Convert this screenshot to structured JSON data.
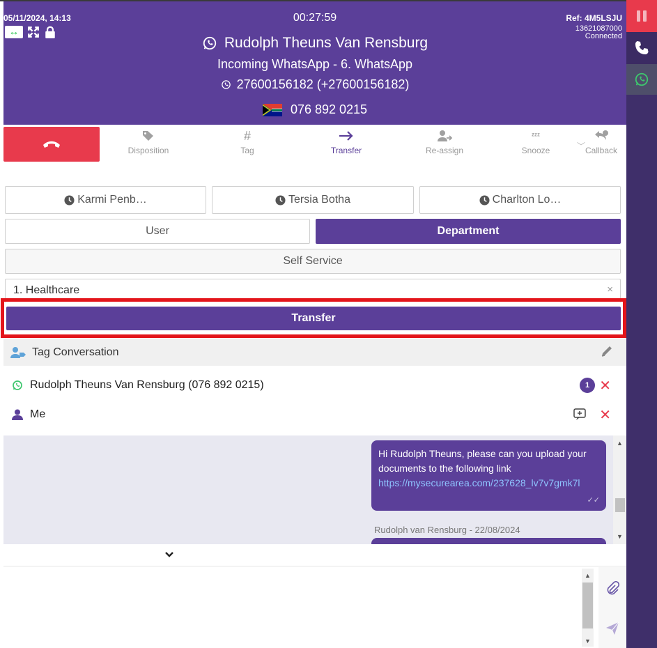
{
  "header": {
    "datetime": "05/11/2024, 14:13",
    "timer": "00:27:59",
    "ref": "Ref: 4M5LSJU",
    "ref_number": "13621087000",
    "status": "Connected",
    "contact_name": "Rudolph Theuns Van Rensburg",
    "interaction_type": "Incoming WhatsApp - 6. WhatsApp",
    "whatsapp_number": "27600156182 (+27600156182)",
    "contact_number": "076 892 0215"
  },
  "toolbar": {
    "items": [
      {
        "label": "Disposition",
        "icon": "tag-icon"
      },
      {
        "label": "Tag",
        "icon": "hash-icon"
      },
      {
        "label": "Transfer",
        "icon": "arrow-right-icon"
      },
      {
        "label": "Re-assign",
        "icon": "user-transfer-icon"
      },
      {
        "label": "Snooze",
        "icon": "snooze-icon"
      },
      {
        "label": "Callback",
        "icon": "callback-icon"
      }
    ]
  },
  "quick_agents": [
    "Karmi Penb…",
    "Tersia Botha",
    "Charlton Lo…"
  ],
  "transfer_modes": {
    "user": "User",
    "department": "Department",
    "self_service": "Self Service"
  },
  "department_select": {
    "value": "1. Healthcare",
    "clear": "×"
  },
  "transfer_button": "Transfer",
  "tag_bar": {
    "label": "Tag Conversation"
  },
  "participants": [
    {
      "name": "Rudolph Theuns Van Rensburg (076 892 0215)",
      "badge": "1"
    },
    {
      "name": "Me"
    }
  ],
  "chat": {
    "message_text": "Hi Rudolph Theuns, please can you upload your documents to the following link",
    "message_link": "https://mysecurearea.com/237628_lv7v7gmk7l",
    "next_sender": "Rudolph van Rensburg - 22/08/2024"
  },
  "colors": {
    "brand": "#5b3f99",
    "danger": "#e83a4c",
    "highlight": "#e3151b"
  }
}
